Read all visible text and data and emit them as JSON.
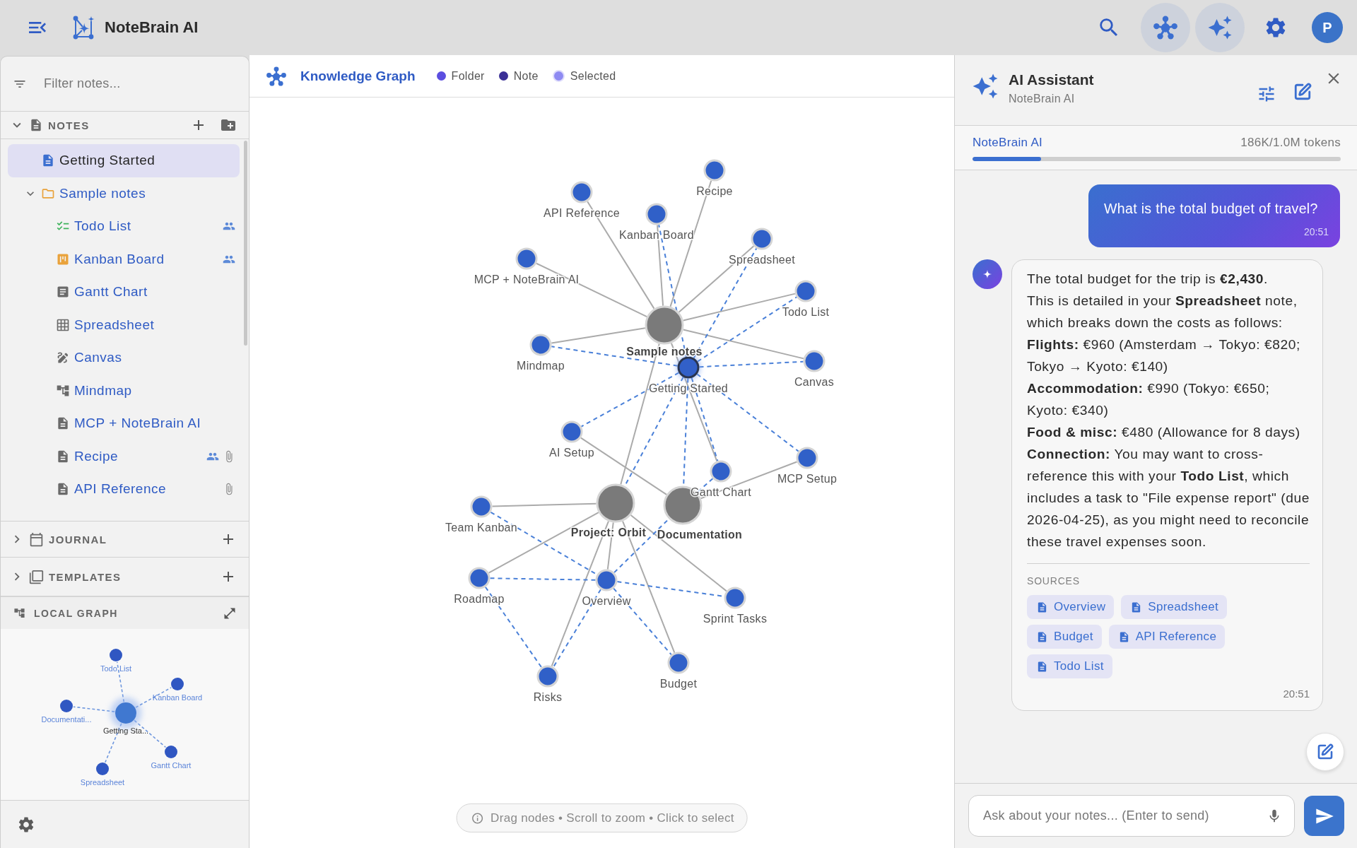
{
  "topbar": {
    "app_name": "NoteBrain AI",
    "buttons": [
      {
        "kind": "search",
        "active": false
      },
      {
        "kind": "graph",
        "active": true
      },
      {
        "kind": "assistant",
        "active": true
      },
      {
        "kind": "settings",
        "active": false
      }
    ],
    "avatar": "P"
  },
  "sidebar": {
    "filter": {
      "placeholder": "Filter notes..."
    },
    "notes": {
      "title": "NOTES",
      "expanded": true,
      "items": [
        {
          "label": "Getting Started",
          "kind": "doc",
          "selected": true,
          "shared": false,
          "attachment": false
        },
        {
          "label": "Sample notes",
          "kind": "folder",
          "selected": false,
          "shared": false,
          "attachment": false,
          "expanded": true,
          "children": [
            {
              "label": "Todo List",
              "kind": "checklist",
              "selected": false,
              "shared": true,
              "attachment": false
            },
            {
              "label": "Kanban Board",
              "kind": "kanban",
              "selected": false,
              "shared": true,
              "attachment": false
            },
            {
              "label": "Gantt Chart",
              "kind": "gantt",
              "selected": false,
              "shared": false,
              "attachment": false
            },
            {
              "label": "Spreadsheet",
              "kind": "spreadsheet",
              "selected": false,
              "shared": false,
              "attachment": false
            },
            {
              "label": "Canvas",
              "kind": "canvas",
              "selected": false,
              "shared": false,
              "attachment": false
            },
            {
              "label": "Mindmap",
              "kind": "mindmap",
              "selected": false,
              "shared": false,
              "attachment": false
            },
            {
              "label": "MCP + NoteBrain AI",
              "kind": "doc",
              "selected": false,
              "shared": false,
              "attachment": false
            },
            {
              "label": "Recipe",
              "kind": "doc",
              "selected": false,
              "shared": true,
              "attachment": true
            },
            {
              "label": "API Reference",
              "kind": "doc",
              "selected": false,
              "shared": false,
              "attachment": true
            }
          ]
        }
      ]
    },
    "sections": [
      {
        "title": "JOURNAL",
        "kind": "journal",
        "expanded": false
      },
      {
        "title": "TEMPLATES",
        "kind": "templates",
        "expanded": false
      }
    ],
    "local_graph": {
      "title": "LOCAL GRAPH",
      "nodes": [
        {
          "label": "Getting Sta...",
          "selected": true
        },
        {
          "label": "Todo List",
          "selected": false
        },
        {
          "label": "Kanban Board",
          "selected": false
        },
        {
          "label": "Documentati...",
          "selected": false
        },
        {
          "label": "Gantt Chart",
          "selected": false
        },
        {
          "label": "Spreadsheet",
          "selected": false
        }
      ]
    }
  },
  "graph": {
    "title": "Knowledge Graph",
    "legend": [
      {
        "label": "Folder",
        "kind": "folder",
        "color": "#5b4ee0"
      },
      {
        "label": "Note",
        "kind": "note",
        "color": "#3a2f96"
      },
      {
        "label": "Selected",
        "kind": "selected",
        "color": "#8e8af2"
      }
    ],
    "nodes": [
      {
        "label": "Recipe",
        "kind": "note",
        "selected": false
      },
      {
        "label": "API Reference",
        "kind": "note",
        "selected": false
      },
      {
        "label": "Kanban Board",
        "kind": "note",
        "selected": false
      },
      {
        "label": "Spreadsheet",
        "kind": "note",
        "selected": false
      },
      {
        "label": "MCP + NoteBrain AI",
        "kind": "note",
        "selected": false
      },
      {
        "label": "Todo List",
        "kind": "note",
        "selected": false
      },
      {
        "label": "Sample notes",
        "kind": "folder",
        "selected": false
      },
      {
        "label": "Mindmap",
        "kind": "note",
        "selected": false
      },
      {
        "label": "Canvas",
        "kind": "note",
        "selected": false
      },
      {
        "label": "Getting Started",
        "kind": "note",
        "selected": true
      },
      {
        "label": "AI Setup",
        "kind": "note",
        "selected": false
      },
      {
        "label": "MCP Setup",
        "kind": "note",
        "selected": false
      },
      {
        "label": "Gantt Chart",
        "kind": "note",
        "selected": false
      },
      {
        "label": "Project: Orbit",
        "kind": "folder",
        "selected": false
      },
      {
        "label": "Documentation",
        "kind": "folder",
        "selected": false
      },
      {
        "label": "Team Kanban",
        "kind": "note",
        "selected": false
      },
      {
        "label": "Roadmap",
        "kind": "note",
        "selected": false
      },
      {
        "label": "Overview",
        "kind": "note",
        "selected": false
      },
      {
        "label": "Sprint Tasks",
        "kind": "note",
        "selected": false
      },
      {
        "label": "Budget",
        "kind": "note",
        "selected": false
      },
      {
        "label": "Risks",
        "kind": "note",
        "selected": false
      }
    ],
    "hint": "Drag nodes • Scroll to zoom • Click to select"
  },
  "assistant": {
    "title": "AI Assistant",
    "subtitle": "NoteBrain AI",
    "usage": {
      "model": "NoteBrain AI",
      "reading": "186K/1.0M tokens",
      "level": 0.186
    },
    "messages": [
      {
        "kind": "user",
        "text": "What is the total budget of travel?",
        "time": "20:51"
      },
      {
        "kind": "assistant",
        "paragraphs": [
          "The total budget for the trip is **€2,430**.",
          "This is detailed in your **Spreadsheet** note, which breaks down the costs as follows:",
          "**Flights:** €960 (Amsterdam → Tokyo: €820; Tokyo → Kyoto: €140)",
          "**Accommodation:** €990 (Tokyo: €650; Kyoto: €340)",
          "**Food & misc:** €480 (Allowance for 8 days)",
          "**Connection:** You may want to cross-reference this with your **Todo List**, which includes a task to \"File expense report\" (due 2026-04-25), as you might need to reconcile these travel expenses soon."
        ],
        "sources_label": "SOURCES",
        "sources": [
          "Overview",
          "Spreadsheet",
          "Budget",
          "API Reference",
          "Todo List"
        ],
        "time": "20:51"
      }
    ],
    "input": {
      "placeholder": "Ask about your notes... (Enter to send)"
    }
  }
}
